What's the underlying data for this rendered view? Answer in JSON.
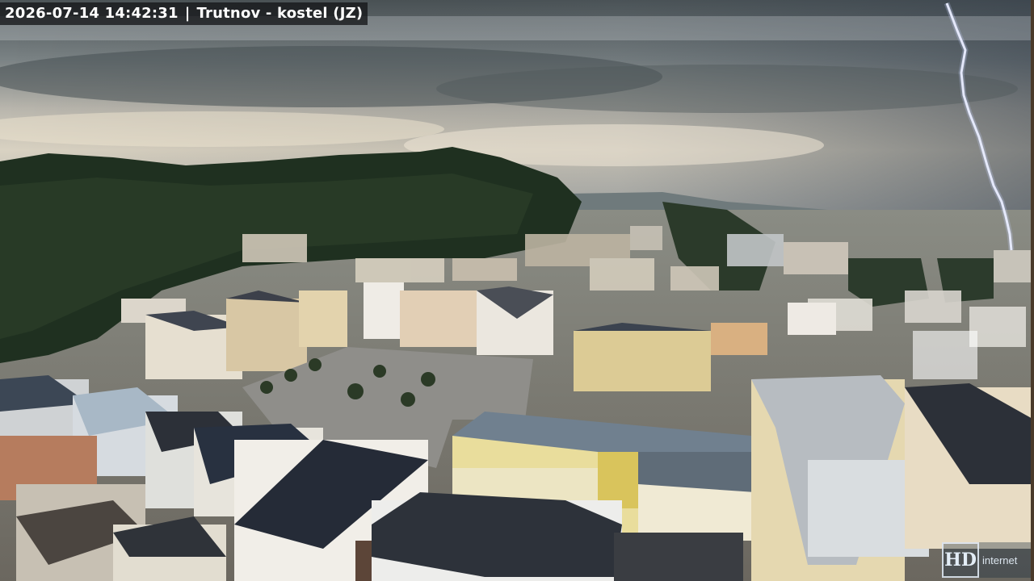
{
  "overlay": {
    "timestamp": "2026-07-14 14:42:31",
    "separator": "|",
    "location": "Trutnov - kostel (JZ)"
  },
  "logo": {
    "mark": "HD",
    "word": "internet"
  },
  "colors": {
    "sky_top": "#5c6568",
    "sky_glow": "#d8d0c0",
    "forest": "#1f3020",
    "square": "#8f8e8a",
    "lightning": "#f4f6ff"
  },
  "icons": {
    "lightning": "lightning-bolt-icon",
    "logo": "hd-internet-logo"
  }
}
